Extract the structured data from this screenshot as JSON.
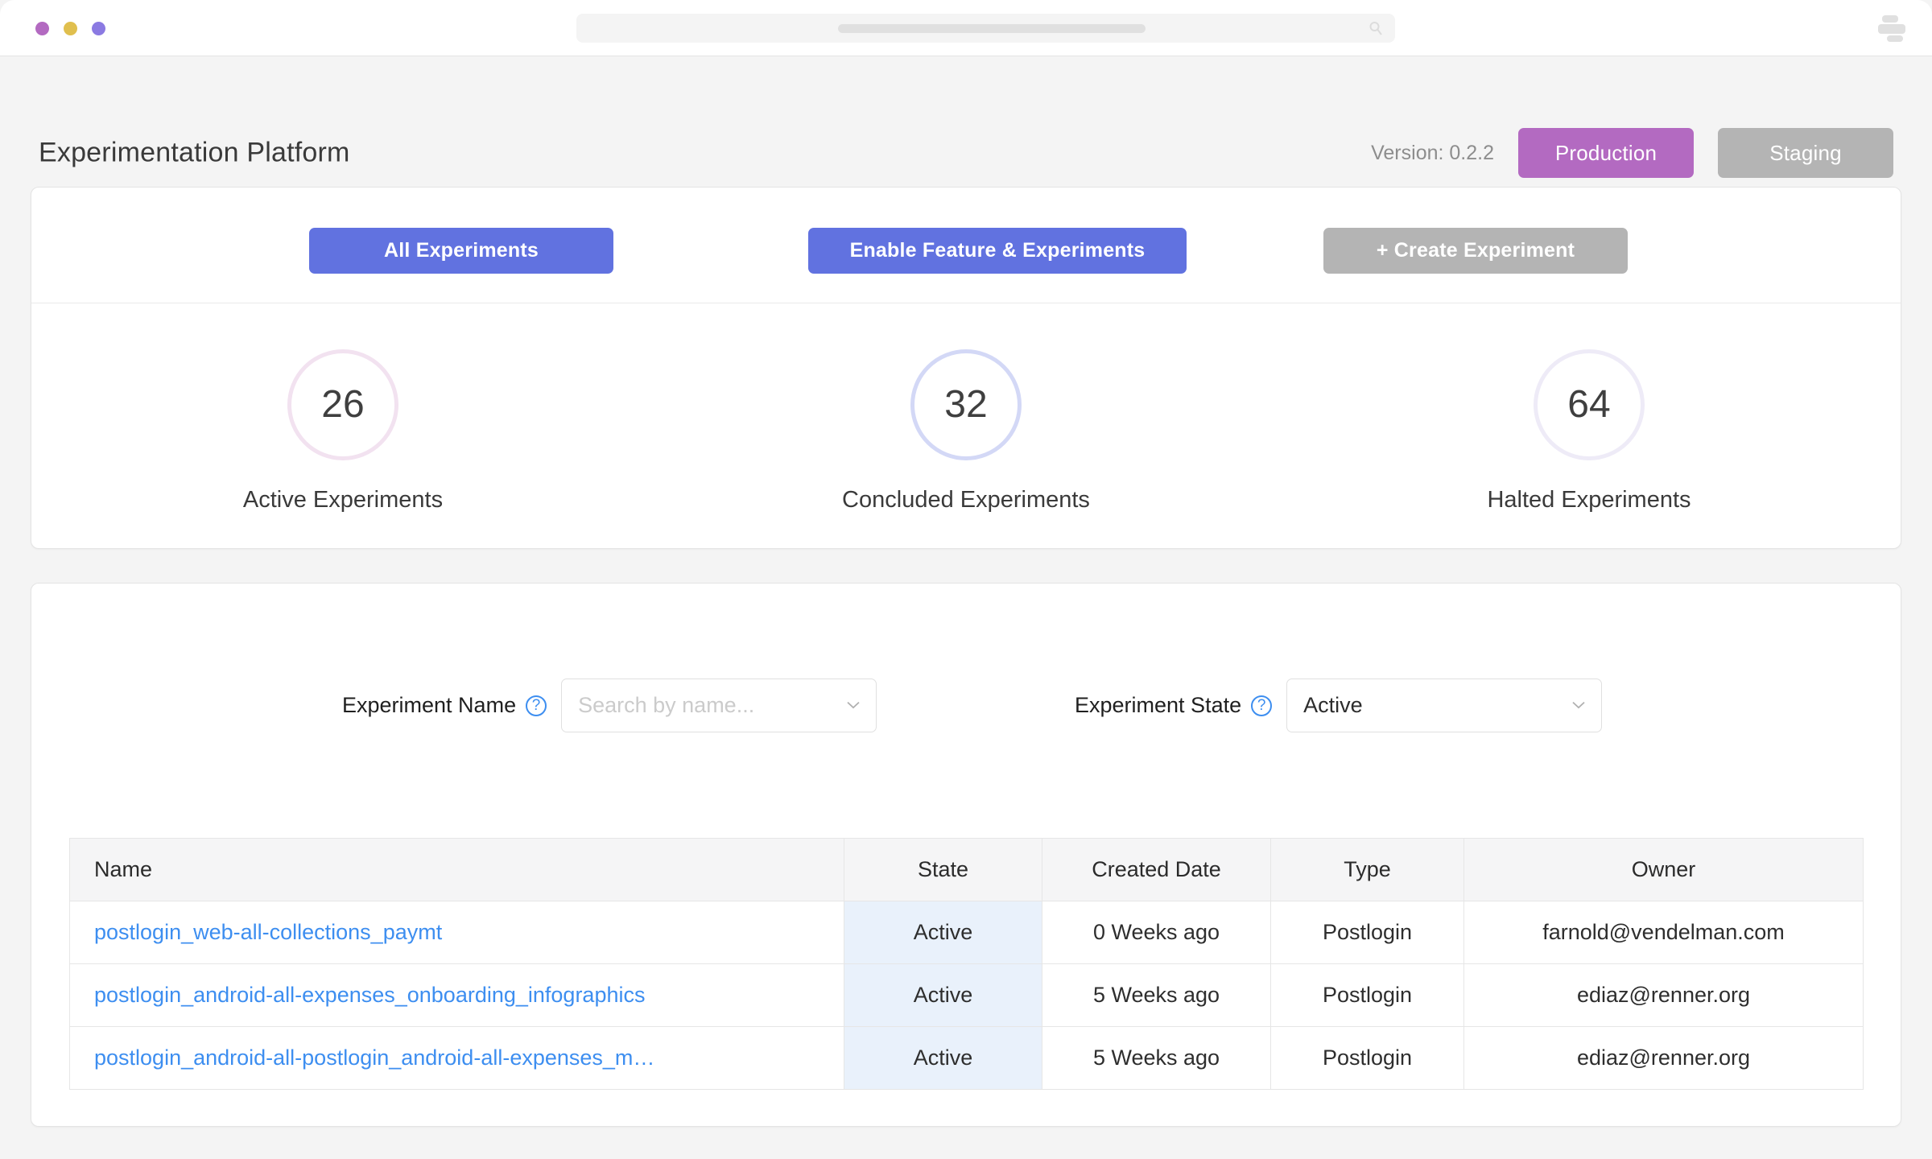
{
  "browser": {
    "dots": [
      "window-dot-purple",
      "window-dot-yellow",
      "window-dot-violet"
    ],
    "omnibox_placeholder": "",
    "search_icon": "search-icon",
    "menu_icon": "menu-icon"
  },
  "header": {
    "title": "Experimentation Platform",
    "version": "Version: 0.2.2",
    "env_buttons": [
      {
        "label": "Production",
        "color": "#b36ac1",
        "active": true
      },
      {
        "label": "Staging",
        "color": "#b4b4b4",
        "active": false
      }
    ]
  },
  "actions": {
    "all_experiments": "All Experiments",
    "enable_feature": "Enable Feature & Experiments",
    "create_experiment": "+ Create Experiment"
  },
  "stats": [
    {
      "value": "26",
      "label": "Active Experiments",
      "ring": "#f2e2f0"
    },
    {
      "value": "32",
      "label": "Concluded  Experiments",
      "ring": "#d3d8f6"
    },
    {
      "value": "64",
      "label": "Halted Experiments",
      "ring": "#eeebf7"
    }
  ],
  "filters": {
    "name": {
      "label": "Experiment Name",
      "help": "?",
      "placeholder": "Search by name...",
      "value": ""
    },
    "state": {
      "label": "Experiment State",
      "help": "?",
      "value": "Active"
    }
  },
  "table": {
    "columns": [
      "Name",
      "State",
      "Created Date",
      "Type",
      "Owner"
    ],
    "rows": [
      {
        "name": "postlogin_web-all-collections_paymt",
        "state": "Active",
        "created": "0 Weeks ago",
        "type": "Postlogin",
        "owner": "farnold@vendelman.com"
      },
      {
        "name": "postlogin_android-all-expenses_onboarding_infographics",
        "state": "Active",
        "created": "5 Weeks ago",
        "type": "Postlogin",
        "owner": "ediaz@renner.org"
      },
      {
        "name": "postlogin_android-all-postlogin_android-all-expenses_m…",
        "state": "Active",
        "created": "5 Weeks ago",
        "type": "Postlogin",
        "owner": "ediaz@renner.org"
      }
    ]
  },
  "colors": {
    "accent_blue": "#6172e0",
    "link_blue": "#3d8ef0",
    "production_purple": "#b36ac1",
    "muted_gray": "#b4b4b4",
    "state_cell_bg": "#e9f1fb"
  }
}
